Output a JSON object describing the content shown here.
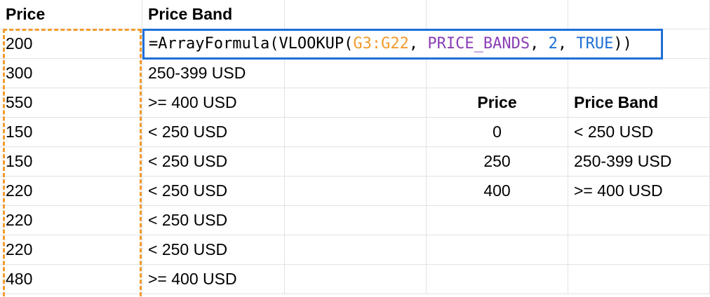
{
  "headers": {
    "price": "Price",
    "price_band": "Price Band"
  },
  "formula": {
    "eq": "=",
    "func1": "ArrayFormula(",
    "func2": "VLOOKUP(",
    "range": "G3:G22",
    "sep1": ", ",
    "named_range": "PRICE_BANDS",
    "sep2": ", ",
    "col_index": "2",
    "sep3": ", ",
    "is_sorted": "TRUE",
    "close": "))",
    "colors": {
      "range": "#f29b2e",
      "named_range": "#8a3fb5",
      "number": "#1f6fd6",
      "selection_border": "#1f6fd6",
      "copy_border": "#f29b2e"
    }
  },
  "rows": [
    {
      "price": "200",
      "band": ""
    },
    {
      "price": "300",
      "band": "250-399 USD"
    },
    {
      "price": "550",
      "band": ">= 400 USD"
    },
    {
      "price": "150",
      "band": "< 250 USD"
    },
    {
      "price": "150",
      "band": "< 250 USD"
    },
    {
      "price": "220",
      "band": "< 250 USD"
    },
    {
      "price": "220",
      "band": "< 250 USD"
    },
    {
      "price": "220",
      "band": "< 250 USD"
    },
    {
      "price": "480",
      "band": ">= 400 USD"
    }
  ],
  "lookup_table": {
    "header_price": "Price",
    "header_band": "Price Band",
    "rows": [
      {
        "price": "0",
        "band": "< 250 USD"
      },
      {
        "price": "250",
        "band": "250-399 USD"
      },
      {
        "price": "400",
        "band": ">= 400 USD"
      }
    ]
  }
}
